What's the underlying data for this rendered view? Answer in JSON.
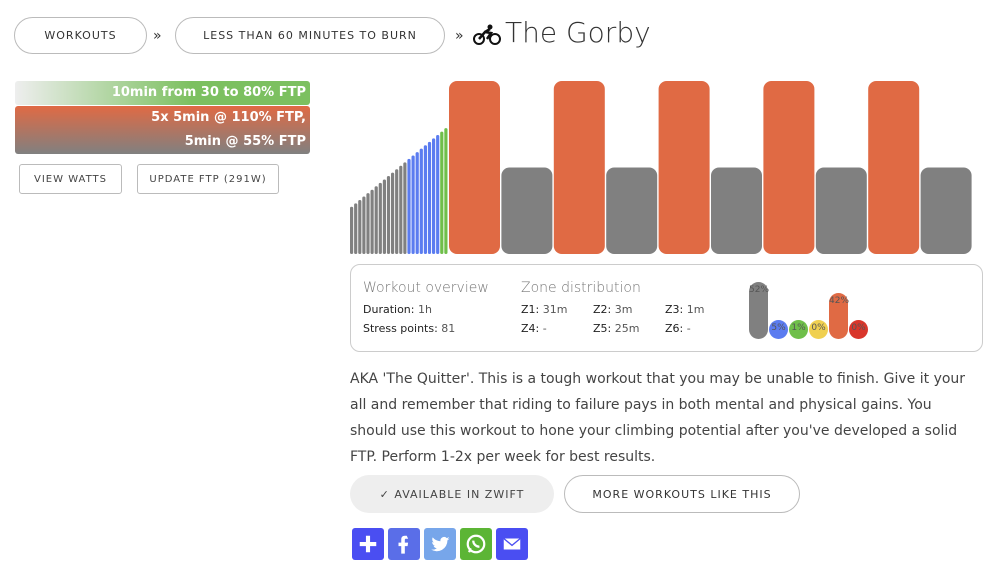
{
  "breadcrumb": {
    "items": [
      "WORKOUTS",
      "LESS THAN 60 MINUTES TO BURN"
    ],
    "separator": "»",
    "title": "The Gorby",
    "title_icon": "bicycle-icon"
  },
  "segments": [
    {
      "text": "10min from 30 to 80% FTP",
      "color": "#7cc060"
    },
    {
      "text": "5x 5min @ 110% FTP,",
      "color": "#e06a44"
    },
    {
      "text": "5min @ 55% FTP",
      "color": "#808080"
    }
  ],
  "buttons": {
    "view_watts": "VIEW WATTS",
    "update_ftp": "UPDATE FTP (291W)"
  },
  "workout_profile": {
    "warmup": {
      "minutes": 10,
      "from_pct_ftp": 30,
      "to_pct_ftp": 80
    },
    "intervals": [
      {
        "minutes": 5,
        "pct_ftp": 110
      },
      {
        "minutes": 5,
        "pct_ftp": 55
      },
      {
        "minutes": 5,
        "pct_ftp": 110
      },
      {
        "minutes": 5,
        "pct_ftp": 55
      },
      {
        "minutes": 5,
        "pct_ftp": 110
      },
      {
        "minutes": 5,
        "pct_ftp": 55
      },
      {
        "minutes": 5,
        "pct_ftp": 110
      },
      {
        "minutes": 5,
        "pct_ftp": 55
      },
      {
        "minutes": 5,
        "pct_ftp": 110
      },
      {
        "minutes": 5,
        "pct_ftp": 55
      }
    ],
    "colors": {
      "z1": "#808080",
      "z2": "#5b7cf0",
      "z3": "#6fbf4a",
      "z5": "#e06a44"
    }
  },
  "overview": {
    "heading": "Workout overview",
    "duration_label": "Duration:",
    "duration": "1h",
    "stress_label": "Stress points:",
    "stress": "81"
  },
  "zones": {
    "heading": "Zone distribution",
    "items": [
      {
        "label": "Z1:",
        "value": "31m"
      },
      {
        "label": "Z2:",
        "value": "3m"
      },
      {
        "label": "Z3:",
        "value": "1m"
      },
      {
        "label": "Z4:",
        "value": "-"
      },
      {
        "label": "Z5:",
        "value": "25m"
      },
      {
        "label": "Z6:",
        "value": "-"
      }
    ],
    "bars": [
      {
        "pct": "52%",
        "value": 52,
        "color": "#808080"
      },
      {
        "pct": "5%",
        "value": 5,
        "color": "#5b7cf0"
      },
      {
        "pct": "1%",
        "value": 1,
        "color": "#6fbf4a"
      },
      {
        "pct": "0%",
        "value": 0,
        "color": "#f0d050"
      },
      {
        "pct": "42%",
        "value": 42,
        "color": "#e06a44"
      },
      {
        "pct": "0%",
        "value": 0,
        "color": "#d9362b"
      }
    ]
  },
  "description": "AKA 'The Quitter'. This is a tough workout that you may be unable to finish. Give it your all and remember that riding to failure pays in both mental and physical gains. You should use this workout to hone your climbing potential after you've developed a solid FTP. Perform 1-2x per week for best results.",
  "actions": {
    "zwift": "✓ AVAILABLE IN ZWIFT",
    "more": "MORE WORKOUTS LIKE THIS"
  },
  "share": [
    {
      "icon": "plus-icon",
      "color": "#4a4ef2"
    },
    {
      "icon": "facebook-icon",
      "color": "#5a6ee8"
    },
    {
      "icon": "twitter-icon",
      "color": "#77a6ea"
    },
    {
      "icon": "whatsapp-icon",
      "color": "#5cb535"
    },
    {
      "icon": "email-icon",
      "color": "#4a4ef2"
    }
  ]
}
